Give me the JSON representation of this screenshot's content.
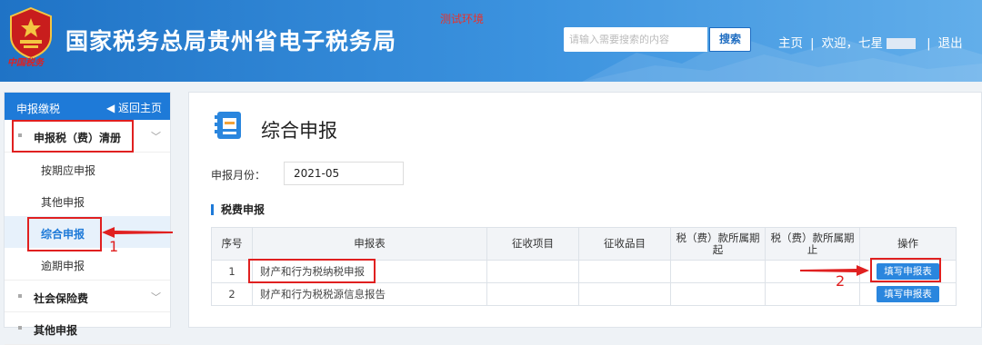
{
  "header": {
    "site_title": "国家税务总局贵州省电子税务局",
    "test_env": "测试环境",
    "search_placeholder": "请输入需要搜索的内容",
    "search_button": "搜索",
    "nav_home": "主页",
    "nav_sep": "|",
    "nav_welcome": "欢迎，七星",
    "nav_logout": "退出",
    "emblem_script": "中国税务",
    "colors": {
      "primary": "#1f73c6",
      "accent": "#3c93df"
    }
  },
  "sidebar": {
    "title": "申报缴税",
    "back_label": "返回主页",
    "groups": [
      {
        "label": "申报税（费）清册",
        "items": [
          "按期应申报",
          "其他申报",
          "综合申报",
          "逾期申报"
        ]
      },
      {
        "label": "社会保险费"
      },
      {
        "label": "其他申报"
      }
    ],
    "active_item": "综合申报"
  },
  "main": {
    "title": "综合申报",
    "month_label": "申报月份：",
    "month_value": "2021-05",
    "section_title": "税费申报",
    "columns": [
      "序号",
      "申报表",
      "征收项目",
      "征收品目",
      "税（费）款所属期起",
      "税（费）款所属期止",
      "操作"
    ],
    "rows": [
      {
        "no": "1",
        "form": "财产和行为税纳税申报",
        "action": "填写申报表"
      },
      {
        "no": "2",
        "form": "财产和行为税税源信息报告",
        "action": "填写申报表"
      }
    ]
  },
  "annotations": {
    "one": "1",
    "two": "2",
    "color": "#e02020"
  }
}
